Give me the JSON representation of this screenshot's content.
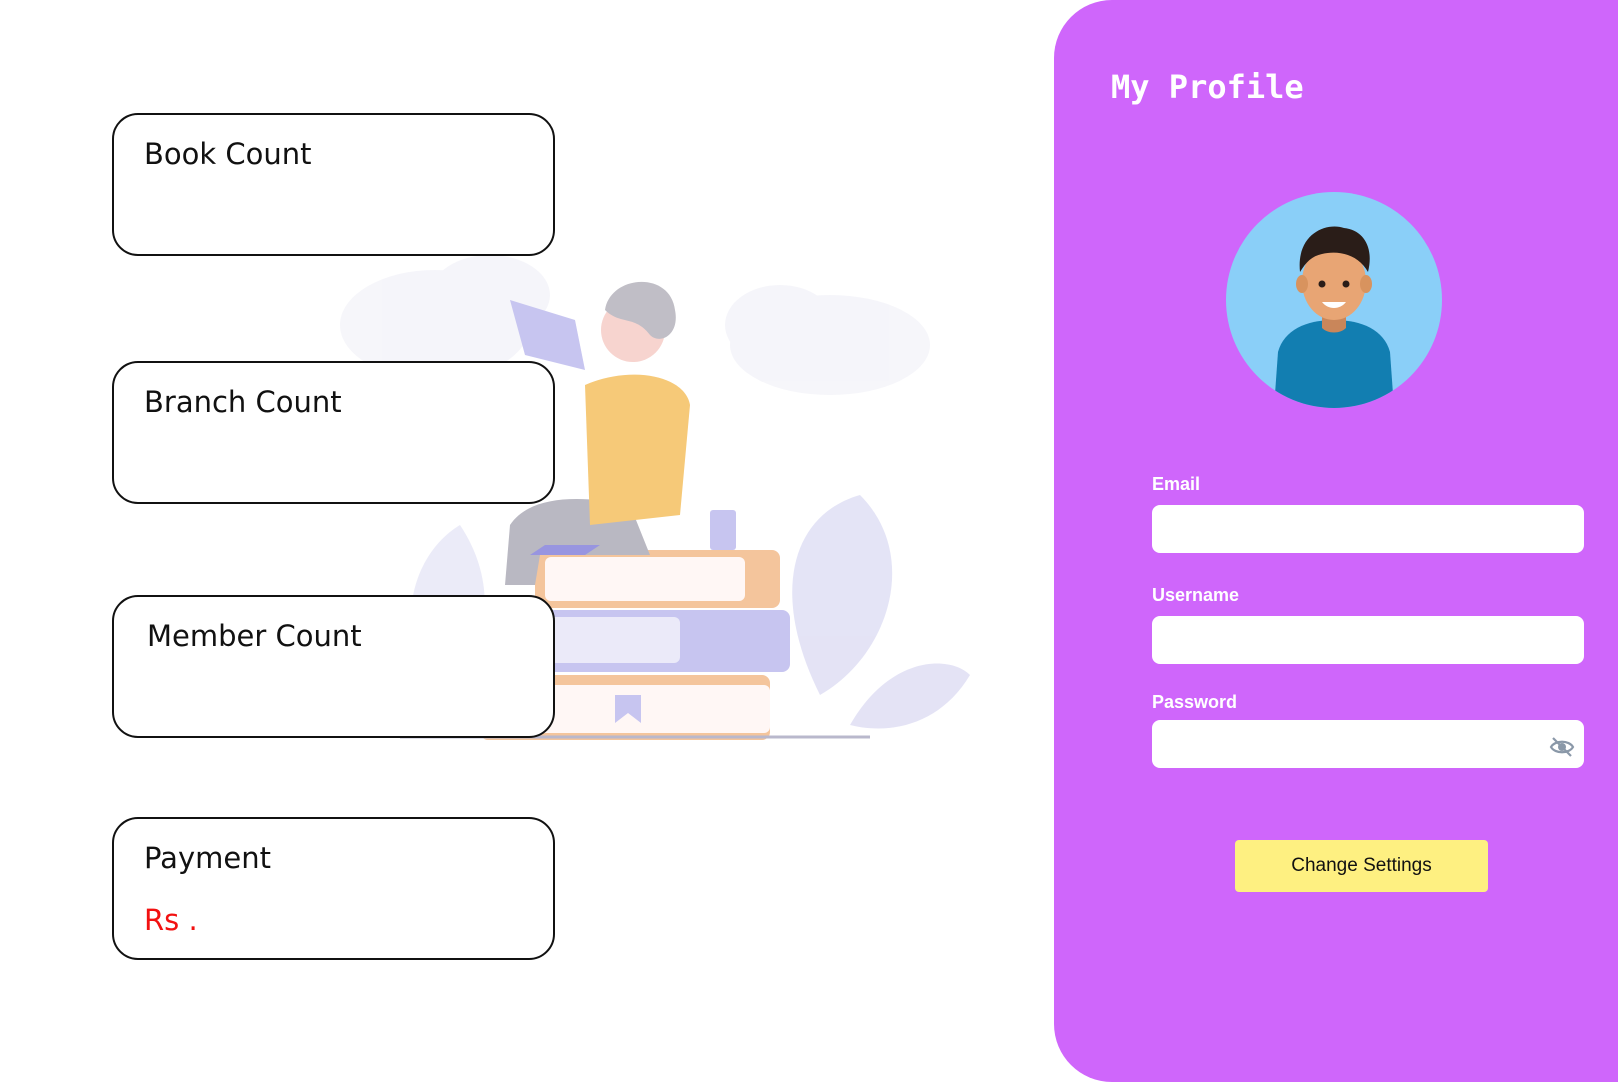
{
  "dashboard": {
    "cards": [
      {
        "title": "Book Count",
        "value": ""
      },
      {
        "title": "Branch Count",
        "value": ""
      },
      {
        "title": "Member Count",
        "value": ""
      },
      {
        "title": "Payment",
        "value": "Rs ."
      }
    ],
    "value_color": "#f21111"
  },
  "profile": {
    "title": "My Profile",
    "fields": {
      "email": {
        "label": "Email",
        "value": ""
      },
      "username": {
        "label": "Username",
        "value": ""
      },
      "password": {
        "label": "Password",
        "value": ""
      }
    },
    "password_toggle_icon": "eye-slash-icon",
    "avatar_icon": "user-avatar-icon",
    "submit_label": "Change Settings"
  },
  "colors": {
    "panel_bg": "#cf66fb",
    "button_bg": "#fef081",
    "avatar_bg": "#8acff8"
  }
}
